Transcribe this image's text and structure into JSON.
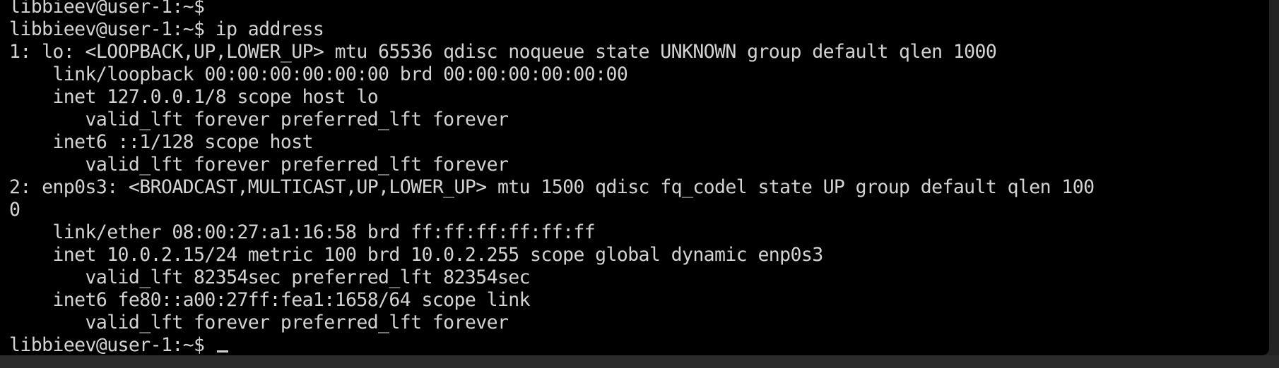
{
  "terminal": {
    "lines": [
      "libbieev@user-1:~$",
      "libbieev@user-1:~$ ip address",
      "1: lo: <LOOPBACK,UP,LOWER_UP> mtu 65536 qdisc noqueue state UNKNOWN group default qlen 1000",
      "    link/loopback 00:00:00:00:00:00 brd 00:00:00:00:00:00",
      "    inet 127.0.0.1/8 scope host lo",
      "       valid_lft forever preferred_lft forever",
      "    inet6 ::1/128 scope host",
      "       valid_lft forever preferred_lft forever",
      "2: enp0s3: <BROADCAST,MULTICAST,UP,LOWER_UP> mtu 1500 qdisc fq_codel state UP group default qlen 100",
      "0",
      "    link/ether 08:00:27:a1:16:58 brd ff:ff:ff:ff:ff:ff",
      "    inet 10.0.2.15/24 metric 100 brd 10.0.2.255 scope global dynamic enp0s3",
      "       valid_lft 82354sec preferred_lft 82354sec",
      "    inet6 fe80::a00:27ff:fea1:1658/64 scope link",
      "       valid_lft forever preferred_lft forever"
    ],
    "prompt": "libbieev@user-1:~$ "
  }
}
